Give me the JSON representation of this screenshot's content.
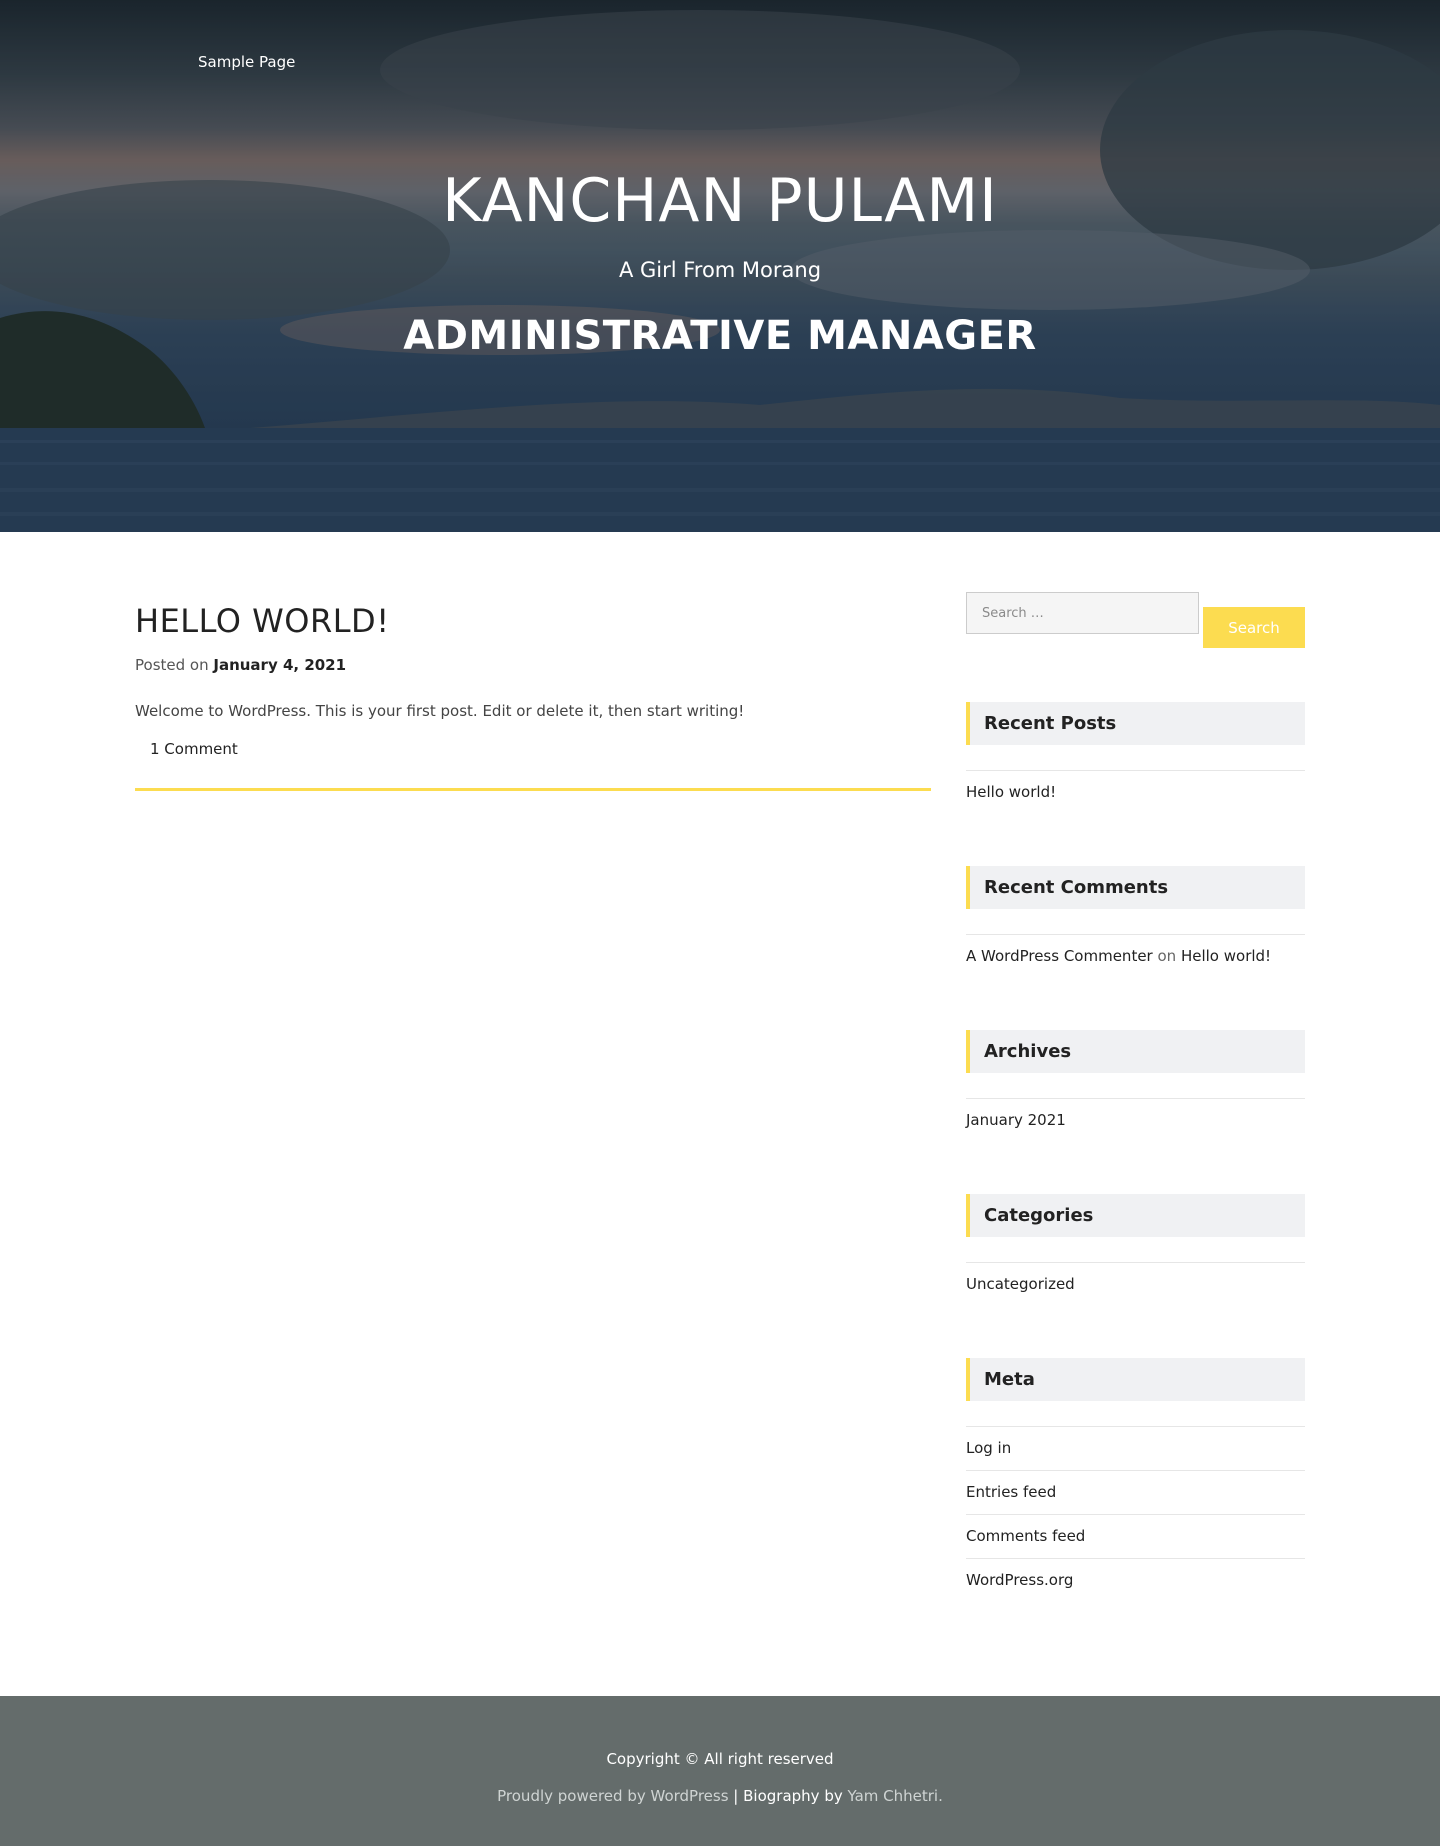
{
  "nav": {
    "items": [
      {
        "label": "Sample Page"
      }
    ]
  },
  "header": {
    "site_title": "KANCHAN PULAMI",
    "tagline": "A Girl From Morang",
    "role": "ADMINISTRATIVE MANAGER"
  },
  "post": {
    "title": "HELLO WORLD!",
    "posted_on_label": "Posted on",
    "date": "January 4, 2021",
    "excerpt": "Welcome to WordPress. This is your first post. Edit or delete it, then start writing!",
    "comments_link": "1 Comment"
  },
  "sidebar": {
    "search": {
      "placeholder": "Search …",
      "button_label": "Search"
    },
    "recent_posts": {
      "title": "Recent Posts",
      "items": [
        "Hello world!"
      ]
    },
    "recent_comments": {
      "title": "Recent Comments",
      "items": [
        {
          "author": "A WordPress Commenter",
          "on": "on",
          "post": "Hello world!"
        }
      ]
    },
    "archives": {
      "title": "Archives",
      "items": [
        "January 2021"
      ]
    },
    "categories": {
      "title": "Categories",
      "items": [
        "Uncategorized"
      ]
    },
    "meta": {
      "title": "Meta",
      "items": [
        "Log in",
        "Entries feed",
        "Comments feed",
        "WordPress.org"
      ]
    }
  },
  "footer": {
    "copyright": "Copyright © All right reserved",
    "powered_by": "Proudly powered by WordPress",
    "separator": " | ",
    "biography_label": "Biography by ",
    "author": "Yam Chhetri."
  },
  "colors": {
    "accent": "#fcdc50",
    "footer_bg": "#646c6b",
    "widget_title_bg": "#f0f1f3"
  }
}
